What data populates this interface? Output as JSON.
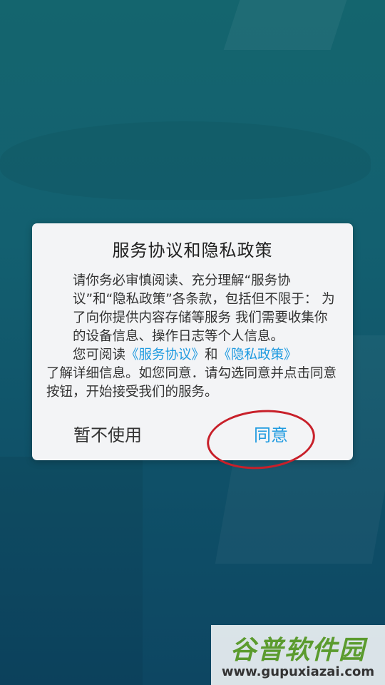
{
  "dialog": {
    "title": "服务协议和隐私政策",
    "paragraph1": "请你务必审慎阅读、充分理解“服务协议”和“隐私政策”各条款，包括但不限于： 为了向你提供内容存储等服务 我们需要收集你的设备信息、操作日志等个人信息。",
    "paragraph2_prefix": "您可阅读",
    "link_service": "《服务协议》",
    "paragraph2_and": "和",
    "link_privacy": "《隐私政策》",
    "paragraph2_suffix": "了解详细信息。如您同意．请勾选同意并点击同意按钮，开始接受我们的服务。",
    "decline_label": "暂不使用",
    "agree_label": "同意"
  },
  "watermark": {
    "title": "谷普软件园",
    "url": "www.gupuxiazai.com"
  },
  "colors": {
    "link": "#1e9ae0",
    "annotation": "#c8202a",
    "background": "#14656e"
  }
}
